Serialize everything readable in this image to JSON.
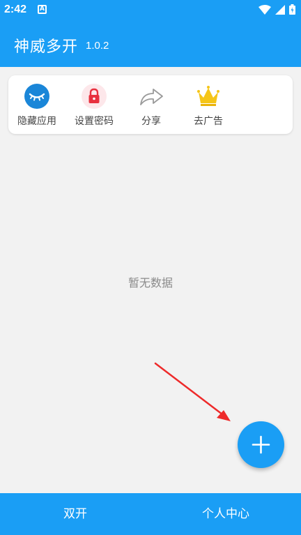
{
  "status_bar": {
    "time": "2:42",
    "notification_icon": "A",
    "icons": [
      "wifi-icon",
      "signal-icon",
      "battery-icon"
    ]
  },
  "app_bar": {
    "title": "神威多开",
    "version": "1.0.2"
  },
  "quick_actions": [
    {
      "label": "隐藏应用",
      "icon": "eye-closed-icon"
    },
    {
      "label": "设置密码",
      "icon": "lock-icon"
    },
    {
      "label": "分享",
      "icon": "share-arrow-icon"
    },
    {
      "label": "去广告",
      "icon": "crown-icon"
    }
  ],
  "empty_state": "暂无数据",
  "fab": {
    "icon": "plus-icon"
  },
  "bottom_tabs": [
    {
      "label": "双开"
    },
    {
      "label": "个人中心"
    }
  ],
  "colors": {
    "primary": "#1a9ef5",
    "background": "#f2f2f2",
    "lock_red": "#e8303e",
    "crown_gold": "#f5c518",
    "arrow_red": "#ee2a2a"
  }
}
